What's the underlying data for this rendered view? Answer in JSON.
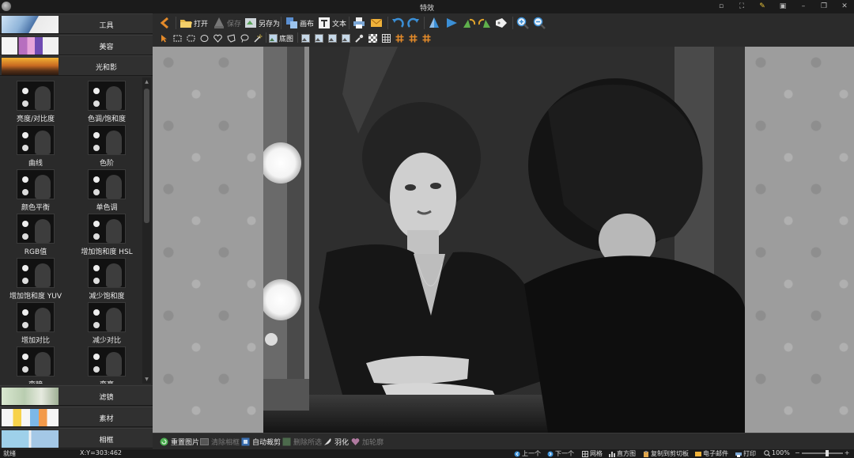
{
  "window": {
    "title": "特效"
  },
  "sidebar": {
    "categories": {
      "tools": "工具",
      "beauty": "美容",
      "light": "光和影",
      "filter": "滤镜",
      "material": "素材",
      "frame": "相框"
    },
    "effects": [
      "亮度/对比度",
      "色调/饱和度",
      "曲线",
      "色阶",
      "颜色平衡",
      "单色调",
      "RGB值",
      "增加饱和度 HSL",
      "增加饱和度 YUV",
      "减少饱和度",
      "增加对比",
      "减少对比",
      "变暗",
      "变亮"
    ]
  },
  "toolbar": {
    "open": "打开",
    "save": "保存",
    "save_as": "另存为",
    "canvas": "画布",
    "text": "文本",
    "base_image": "底图"
  },
  "bottombar": {
    "reset": "重置图片",
    "clear_frame": "清除相框",
    "auto_crop": "自动裁剪",
    "delete_selection": "删除所选",
    "feather": "羽化",
    "add_border": "加轮廓"
  },
  "statusbar": {
    "ready": "就绪",
    "coords": "X:Y=303:462",
    "prev": "上一个",
    "next": "下一个",
    "grid": "网格",
    "histogram": "直方图",
    "copy_clipboard": "复制到剪切板",
    "email": "电子邮件",
    "print": "打印",
    "zoom": "100%"
  },
  "colors": {
    "accent_orange": "#e38a2a",
    "accent_blue": "#3b8fd6",
    "panel": "#2b2b2b"
  }
}
